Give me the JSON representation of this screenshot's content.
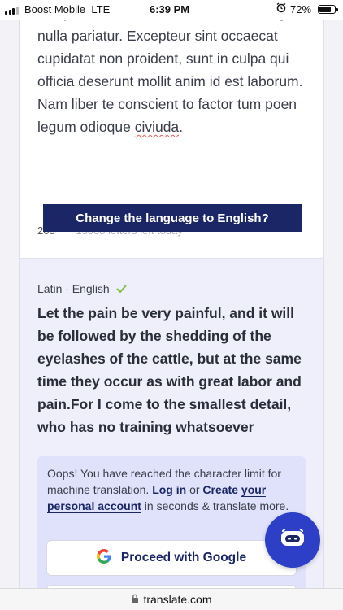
{
  "status_bar": {
    "carrier": "Boost Mobile",
    "network": "LTE",
    "time": "6:39 PM",
    "battery_percent": "72%",
    "battery_level": 0.72,
    "icons": [
      "signal-icon",
      "alarm-icon",
      "battery-icon"
    ]
  },
  "source": {
    "text_main": "voluptate velit esse cillum dolore eu fugiat nulla pariatur. Excepteur sint occaecat cupidatat non proident, sunt in culpa qui officia deserunt mollit anim id est laborum. Nam liber te conscient to factor tum poen legum odioque",
    "text_last_word": "civiuda",
    "text_period": ".",
    "char_count": "200",
    "letters_left": "13000 letters left today"
  },
  "language_banner": {
    "label": "Change the language to English?"
  },
  "translation": {
    "language_pair": "Latin - English",
    "text": "Let the pain be very painful, and it will be followed by the shedding of the eyelashes of the cattle, but at the same time they occur as with great labor and pain.For I come to the smallest detail, who has no training whatsoever"
  },
  "limit_notice": {
    "prefix": "Oops! You have reached the character limit for machine translation. ",
    "login_link": "Log in",
    "or": " or ",
    "create_link_part1": "Create",
    "create_link_part2": "your personal account",
    "suffix": " in seconds & translate more.",
    "google_button": "Proceed with Google"
  },
  "browser": {
    "url": "translate.com"
  },
  "colors": {
    "brand_navy": "#1a2666",
    "fab_blue": "#2c3fc6",
    "check_green": "#7bc043"
  }
}
